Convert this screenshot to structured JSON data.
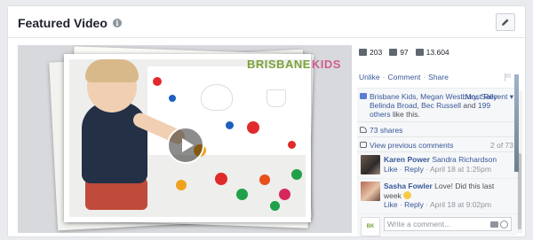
{
  "header": {
    "title": "Featured Video",
    "info_icon": "info-icon",
    "edit_icon": "pencil-icon"
  },
  "video": {
    "brand_left": "BRISBANE",
    "brand_right": "KIDS",
    "play_icon": "play-icon"
  },
  "stats": {
    "likes": "203",
    "comments": "97",
    "views": "13.604"
  },
  "actions": {
    "unlike": "Unlike",
    "comment": "Comment",
    "share": "Share"
  },
  "likes_row": {
    "names": "Brisbane Kids, Megan Westbury, Sally Belinda Broad, Bec Russell",
    "and_text": " and ",
    "others": "199 others",
    "tail": " like this.",
    "sort": "Most Recent ▾"
  },
  "shares": "73 shares",
  "previous": {
    "label": "View previous comments",
    "count": "2 of 73"
  },
  "comments": [
    {
      "author": "Karen Power",
      "text": " Sandra Richardson",
      "like": "Like",
      "reply": "Reply",
      "time": "April 18 at 1:25pm"
    },
    {
      "author": "Sasha Fowler",
      "text": " Love! Did this last week ",
      "like": "Like",
      "reply": "Reply",
      "time": "April 18 at 9:02pm"
    }
  ],
  "write": {
    "placeholder": "Write a comment..."
  },
  "colors": {
    "link": "#385898",
    "brand_green": "#7aa23a",
    "brand_pink": "#d15d8f"
  }
}
